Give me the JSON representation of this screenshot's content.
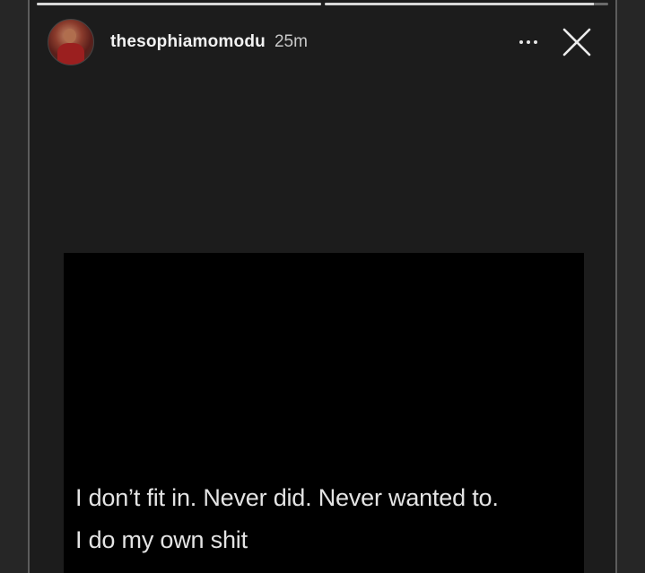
{
  "story": {
    "username": "thesophiamomodu",
    "time_ago": "25m",
    "progress": [
      1.0,
      0.95
    ],
    "caption_lines": [
      "I don’t fit in. Never did. Never wanted to.",
      "I do my own shit"
    ]
  },
  "icons": {
    "more": "more-options-icon",
    "close": "close-icon",
    "avatar": "profile-avatar"
  },
  "colors": {
    "background": "#1c1c1c",
    "content": "#000000",
    "text": "#e4e4e4"
  }
}
